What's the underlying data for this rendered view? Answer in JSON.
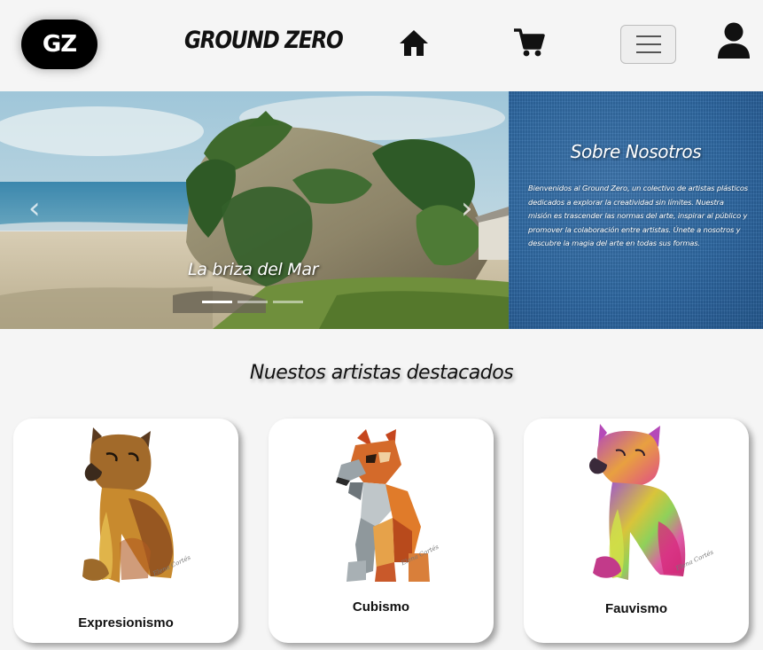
{
  "navbar": {
    "logo_text": "GZ",
    "brand": "GROUND ZERO",
    "icons": [
      "home-icon",
      "cart-icon",
      "menu-icon",
      "user-icon"
    ]
  },
  "carousel": {
    "caption": "La briza del Mar",
    "prev_icon": "‹",
    "next_icon": "›",
    "slide_count": 3,
    "active_index": 0
  },
  "about": {
    "title": "Sobre Nosotros",
    "text": "Bienvenidos al Ground Zero, un colectivo de artistas plásticos dedicados a explorar la creatividad sin límites. Nuestra misión es trascender las normas del arte, inspirar al público y promover la colaboración entre artistas. Únete a nosotros y descubre la magia del arte en todas sus formas."
  },
  "featured": {
    "title": "Nuestos artistas destacados",
    "cards": [
      {
        "label": "Expresionismo",
        "signature": "Elena Cortés"
      },
      {
        "label": "Cubismo",
        "signature": "Elena Cortés"
      },
      {
        "label": "Fauvismo",
        "signature": "Elena Cortés"
      }
    ]
  },
  "colors": {
    "about_bg": "#2f6aa5",
    "logo_bg": "#000000",
    "page_bg": "#f5f5f5"
  }
}
